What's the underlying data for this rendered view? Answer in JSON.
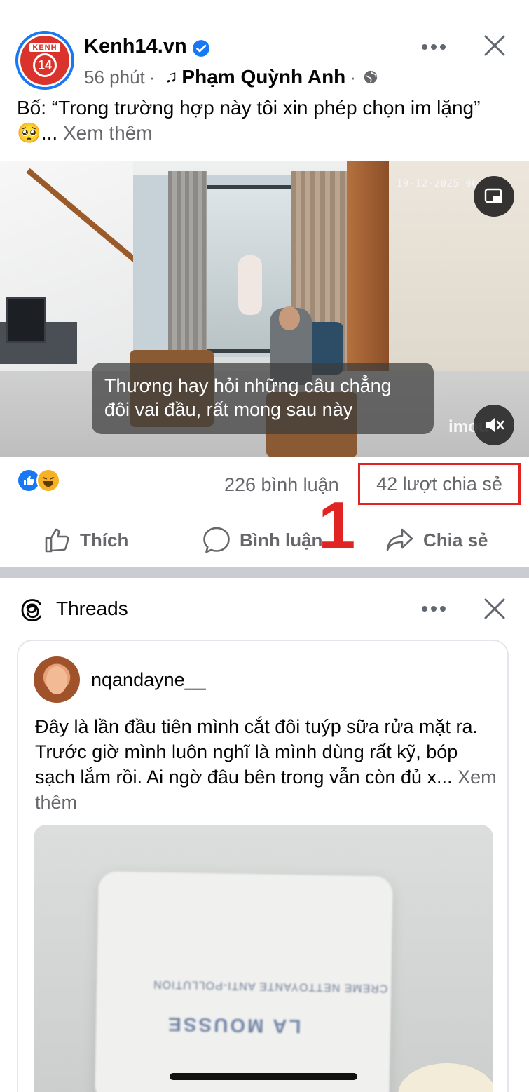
{
  "post": {
    "page_name": "Kenh14.vn",
    "avatar_brand": "KENH",
    "avatar_number": "14",
    "time": "56 phút",
    "music_artist": "Phạm Quỳnh Anh",
    "caption_text": "Bố: “Trong trường hợp này tôi xin phép chọn im lặng” 🥺...",
    "caption_see_more": "Xem thêm",
    "video": {
      "timestamp": "19-12-2025 06",
      "subtitle": "Thương hay hỏi những câu chẳng đôi vai đầu, rất mong sau này",
      "watermark": "imou"
    },
    "stats": {
      "comments": "226 bình luận",
      "shares": "42 lượt chia sẻ"
    },
    "annotation_number": "1",
    "actions": {
      "like": "Thích",
      "comment": "Bình luận",
      "share": "Chia sẻ"
    }
  },
  "threads": {
    "title": "Threads",
    "username": "nqandayne__",
    "body_text": "Đây là lần đầu tiên mình cắt đôi tuýp sữa rửa mặt ra. Trước giờ mình luôn nghĩ là mình dùng rất kỹ, bóp sạch lắm rồi. Ai ngờ đâu bên trong vẫn còn đủ x...",
    "see_more": "Xem thêm",
    "image_label_small": "CREME NETTOYANTE ANTI-POLLUTION",
    "image_label_big": "LA MOUSSE"
  },
  "colors": {
    "accent": "#1877f2",
    "annotation_red": "#e02424",
    "muted_text": "#65676b"
  }
}
